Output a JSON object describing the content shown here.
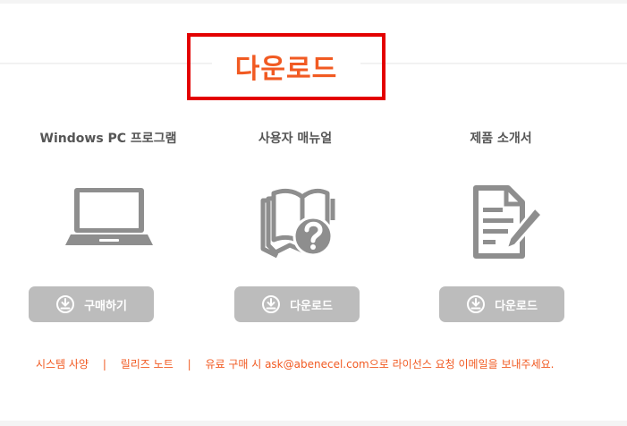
{
  "title": "다운로드",
  "columns": [
    {
      "title": "Windows PC 프로그램",
      "icon": "laptop-icon",
      "button": "구매하기"
    },
    {
      "title": "사용자 매뉴얼",
      "icon": "manual-question-icon",
      "button": "다운로드"
    },
    {
      "title": "제품 소개서",
      "icon": "document-pen-icon",
      "button": "다운로드"
    }
  ],
  "footer": {
    "system_spec": "시스템 사양",
    "separator": "|",
    "release_notes": "릴리즈 노트",
    "license_text": "유료 구매 시 ask@abenecel.com으로 라이선스 요청 이메일을 보내주세요."
  },
  "colors": {
    "accent": "#f15a22",
    "highlight_border": "#e30000",
    "button_bg": "#bcbcbc",
    "icon_gray": "#8e8e8e"
  }
}
